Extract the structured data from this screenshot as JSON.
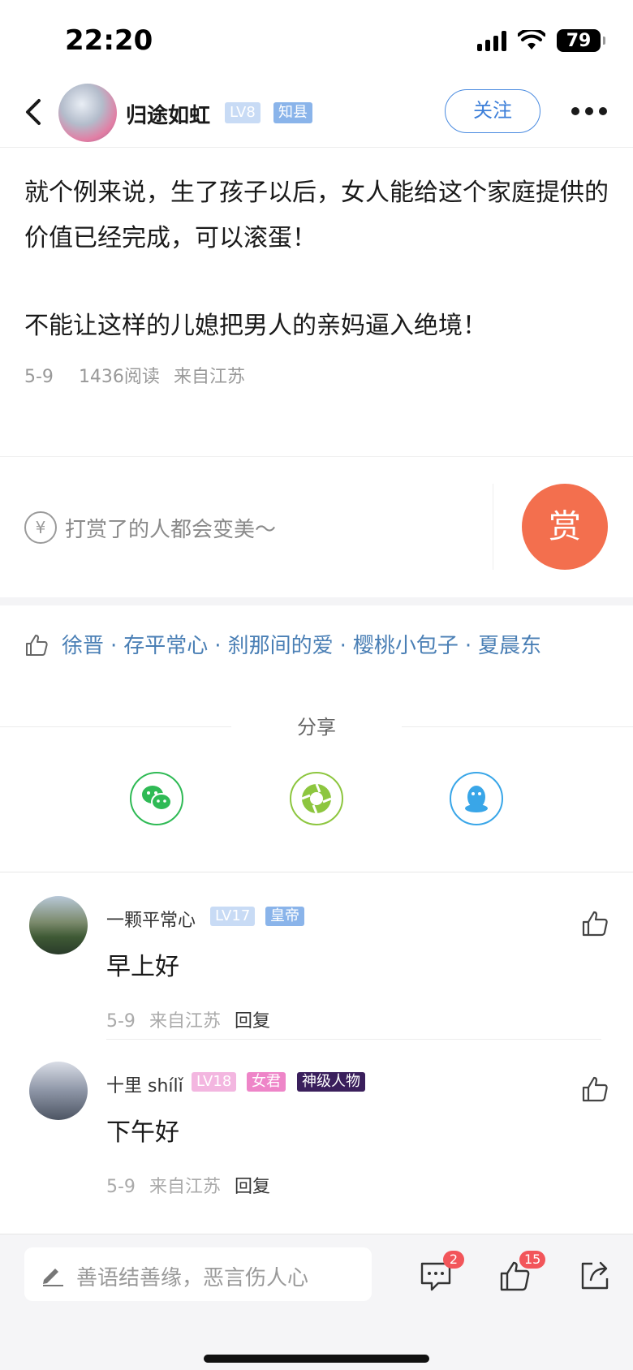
{
  "status_bar": {
    "time": "22:20",
    "battery": "79"
  },
  "header": {
    "author_name": "归途如虹",
    "level_badge": "LV8",
    "title_badge": "知县",
    "follow_label": "关注"
  },
  "post": {
    "paragraphs": [
      "就个例来说，生了孩子以后，女人能给这个家庭提供的价值已经完成，可以滚蛋！",
      "不能让这样的儿媳把男人的亲妈逼入绝境！"
    ],
    "date": "5-9",
    "reads": "1436阅读",
    "location": "来自江苏"
  },
  "reward": {
    "icon_symbol": "¥",
    "prompt": "打赏了的人都会变美～",
    "button_label": "赏"
  },
  "likers": {
    "names": [
      "徐晋",
      "存平常心",
      "刹那间的爱",
      "樱桃小包子",
      "夏晨东"
    ],
    "separator": "·"
  },
  "share": {
    "label": "分享",
    "targets": [
      "wechat-icon",
      "moments-icon",
      "qq-icon"
    ]
  },
  "comments": [
    {
      "name": "一颗平常心",
      "level": "LV17",
      "title": "皇帝",
      "text": "早上好",
      "date": "5-9",
      "location": "来自江苏",
      "reply": "回复"
    },
    {
      "name": "十里 shílǐ",
      "level": "LV18",
      "title": "女君",
      "special": "神级人物",
      "text": "下午好",
      "date": "5-9",
      "location": "来自江苏",
      "reply": "回复"
    }
  ],
  "bottom_bar": {
    "input_placeholder": "善语结善缘，恶言伤人心",
    "comment_count": "2",
    "like_count": "15"
  },
  "colors": {
    "accent_blue": "#3d7fd9",
    "reward_orange": "#f36f4e",
    "liker_blue": "#4a7fb5",
    "badge_red": "#f2555a"
  }
}
